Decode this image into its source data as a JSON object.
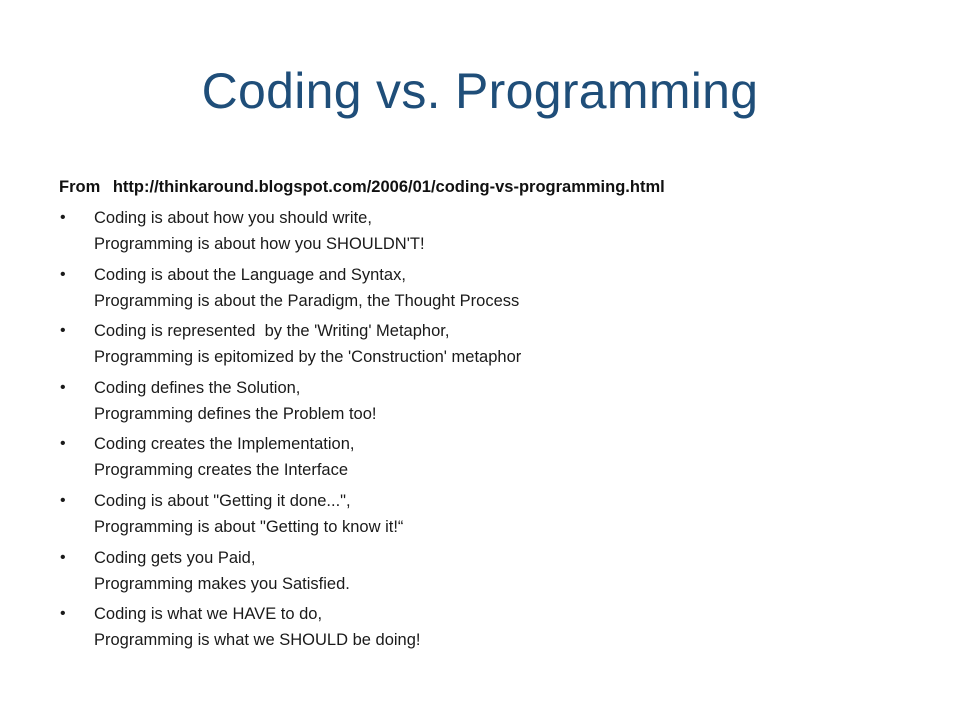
{
  "slide": {
    "title": "Coding vs. Programming",
    "title_color": "#1f4e79",
    "source": {
      "label": "From",
      "url": "http://thinkaround.blogspot.com/2006/01/coding-vs-programming.html"
    },
    "bullet_glyph": "•",
    "bullets": [
      {
        "line1": "Coding is about how you should write,",
        "line2": "Programming is about how you SHOULDN'T!"
      },
      {
        "line1": "Coding is about the Language and Syntax,",
        "line2": "Programming is about the Paradigm, the Thought Process"
      },
      {
        "line1": "Coding is represented  by the 'Writing' Metaphor,",
        "line2": "Programming is epitomized by the 'Construction' metaphor"
      },
      {
        "line1": "Coding defines the Solution,",
        "line2": "Programming defines the Problem too!"
      },
      {
        "line1": "Coding creates the Implementation,",
        "line2": "Programming creates the Interface"
      },
      {
        "line1": "Coding is about \"Getting it done...\",",
        "line2": "Programming is about \"Getting to know it!“"
      },
      {
        "line1": "Coding gets you Paid,",
        "line2": "Programming makes you Satisfied."
      },
      {
        "line1": "Coding is what we HAVE to do,",
        "line2": "Programming is what we SHOULD be doing!"
      }
    ]
  }
}
